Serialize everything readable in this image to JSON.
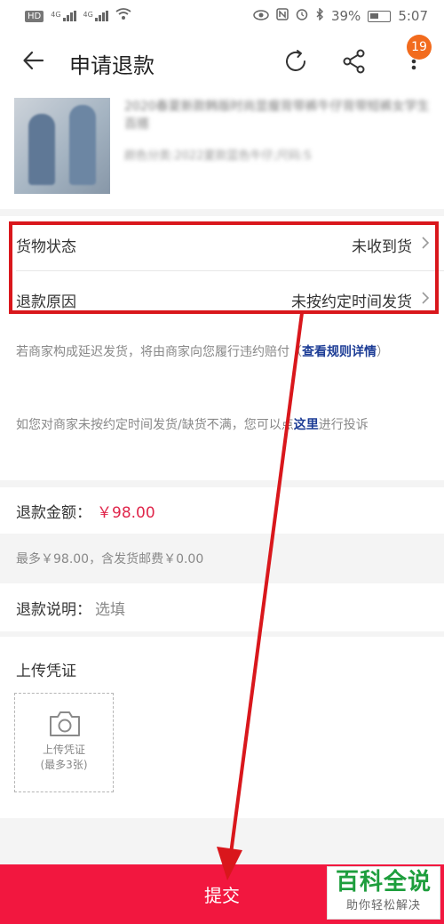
{
  "status_bar": {
    "left_badge": "HD",
    "signal_label": "4G",
    "battery": "39%",
    "time": "5:07"
  },
  "header": {
    "title": "申请退款",
    "notification_count": "19"
  },
  "product": {
    "title": "2020春夏新款韩版时尚显瘦背带裤牛仔背带短裤女学生百搭",
    "spec": "颜色分类:2022夏款蓝色牛仔;尺码:S"
  },
  "form": {
    "goods_status_label": "货物状态",
    "goods_status_value": "未收到货",
    "reason_label": "退款原因",
    "reason_value": "未按约定时间发货"
  },
  "notes": {
    "delay_text": "若商家构成延迟发货，将由商家向您履行违约赔付（",
    "rules_link": "查看规则详情",
    "delay_close": "）",
    "complain_text": "如您对商家未按约定时间发货/缺货不满，您可以点",
    "here_link": "这里",
    "complain_tail": "进行投诉"
  },
  "refund": {
    "amount_label": "退款金额：",
    "amount_value": "￥98.00",
    "max_note": "最多￥98.00，含发货邮费￥0.00",
    "explain_label": "退款说明：",
    "explain_placeholder": "选填"
  },
  "upload": {
    "title": "上传凭证",
    "box_line1": "上传凭证",
    "box_line2": "(最多3张)"
  },
  "submit_label": "提交",
  "watermark": {
    "line1": "百科全说",
    "line2": "助你轻松解决"
  },
  "colors": {
    "accent_red": "#f2173f",
    "annotation_red": "#d9171c",
    "price_pink": "#e0264b",
    "link_blue": "#1d3d96",
    "badge_orange": "#f26b1d"
  }
}
